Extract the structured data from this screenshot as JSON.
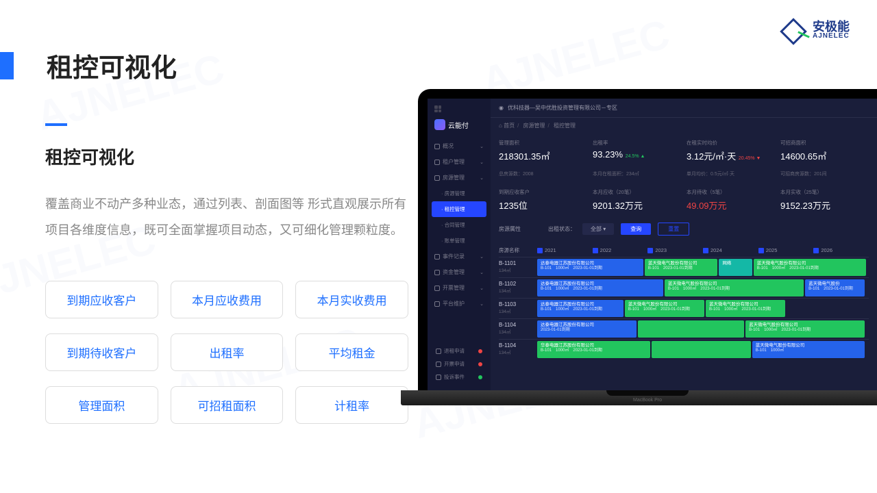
{
  "logo": {
    "cn": "安极能",
    "en": "AJNELEC"
  },
  "page": {
    "title": "租控可视化",
    "subtitle": "租控可视化",
    "desc": "覆盖商业不动产多种业态，通过列表、剖面图等 形式直观展示所有项目各维度信息，既可全面掌握项目动态，又可细化管理颗粒度。"
  },
  "tags": [
    "到期应收客户",
    "本月应收费用",
    "本月实收费用",
    "到期待收客户",
    "出租率",
    "平均租金",
    "管理面积",
    "可招租面积",
    "计租率"
  ],
  "app": {
    "brand": "云能付",
    "topbar": "优科技器—吴中优胜投资管理有限公司－专区",
    "crumb": [
      "首页",
      "房源管理",
      "租控管理"
    ],
    "nav": [
      {
        "label": "概况",
        "type": "main",
        "chev": "⌄"
      },
      {
        "label": "租户管理",
        "type": "main",
        "chev": "⌄"
      },
      {
        "label": "房源管理",
        "type": "main",
        "chev": "⌄"
      },
      {
        "label": "房源管理",
        "type": "sub"
      },
      {
        "label": "租控管理",
        "type": "sub",
        "active": true
      },
      {
        "label": "合同管理",
        "type": "sub"
      },
      {
        "label": "账单管理",
        "type": "sub"
      },
      {
        "label": "事件记录",
        "type": "main",
        "chev": "⌄"
      },
      {
        "label": "资金管理",
        "type": "main",
        "chev": "⌄"
      },
      {
        "label": "开票管理",
        "type": "main",
        "chev": "⌄"
      },
      {
        "label": "平台维护",
        "type": "main",
        "chev": "⌄"
      }
    ],
    "sidebarBottom": [
      {
        "label": "退租申请",
        "dot": "red"
      },
      {
        "label": "开票申请",
        "dot": "red"
      },
      {
        "label": "投诉事件",
        "dot": "green"
      }
    ],
    "stats": [
      {
        "label": "管理面积",
        "value": "218301.35㎡",
        "sub": "总房源数：2008"
      },
      {
        "label": "出租率",
        "value": "93.23%",
        "pct": "24.5% ▲",
        "sub": "本月在租面积：234㎡"
      },
      {
        "label": "在租实时均价",
        "value": "3.12元/㎡·天",
        "pct": "20.45% ▼",
        "pctClass": "red",
        "sub": "单月均价：0.5元/㎡·天"
      },
      {
        "label": "可招商面积",
        "value": "14600.65㎡",
        "sub": "可招商房源数：201间"
      }
    ],
    "stats2": [
      {
        "label": "到期应收客户",
        "value": "1235位"
      },
      {
        "label": "本月应收（20笔）",
        "value": "9201.32万元"
      },
      {
        "label": "本月待收（5笔）",
        "value": "49.09万元",
        "class": "red"
      },
      {
        "label": "本月实收（25笔）",
        "value": "9152.23万元"
      }
    ],
    "filter": {
      "src": "房源属性",
      "state": "出租状态：",
      "sel": "全部",
      "btn1": "查询",
      "btn2": "重置"
    },
    "ganttHead": {
      "room": "房源名称",
      "years": [
        "2021",
        "2022",
        "2023",
        "2024",
        "2025",
        "2026"
      ]
    },
    "ganttRows": [
      {
        "room": "B-1101",
        "sub": "134㎡",
        "bars": [
          {
            "w": "32%",
            "c": "blue",
            "t": "达泰电器江苏股份有限公司",
            "s": "B-101　1000㎡　2023-01-01到期"
          },
          {
            "w": "22%",
            "c": "green",
            "t": "蓝天微电气股份有限公司",
            "s": "B-101　2023-01-01到期"
          },
          {
            "w": "10%",
            "c": "teal",
            "t": "网络",
            "s": ""
          },
          {
            "w": "34%",
            "c": "green",
            "t": "蓝天微电气股份有限公司",
            "s": "B-101　1000㎡　2023-01-01到期"
          }
        ]
      },
      {
        "room": "B-1102",
        "sub": "134㎡",
        "bars": [
          {
            "w": "38%",
            "c": "blue",
            "t": "达泰电器江苏股份有限公司",
            "s": "B-101　1000㎡　2023-01-01到期"
          },
          {
            "w": "42%",
            "c": "green",
            "t": "蓝天微电气股份有限公司",
            "s": "B-101　1000㎡　2023-01-01到期"
          },
          {
            "w": "18%",
            "c": "blue",
            "t": "蓝天微电气股份",
            "s": "B-101　2023-01-01到期"
          }
        ]
      },
      {
        "room": "B-1103",
        "sub": "134㎡",
        "bars": [
          {
            "w": "26%",
            "c": "blue",
            "t": "达泰电器江苏股份有限公司",
            "s": "B-101　1000㎡　2023-01-01到期"
          },
          {
            "w": "24%",
            "c": "green",
            "t": "蓝天微电气股份有限公司",
            "s": "B-101　1000㎡　2023-01-01到期"
          },
          {
            "w": "24%",
            "c": "green",
            "t": "蓝天微电气股份有限公司",
            "s": "B-101　1000㎡　2023-01-01到期"
          }
        ]
      },
      {
        "room": "B-1104",
        "sub": "134㎡",
        "bars": [
          {
            "w": "30%",
            "c": "blue",
            "t": "达泰电器江苏股份有限公司",
            "s": "2023-01-01到期"
          },
          {
            "w": "32%",
            "c": "green",
            "t": "",
            "s": ""
          },
          {
            "w": "36%",
            "c": "green",
            "t": "蓝天微电气股份有限公司",
            "s": "B-101　1000㎡　2023-01-01到期"
          }
        ]
      },
      {
        "room": "B-1104",
        "sub": "134㎡",
        "bars": [
          {
            "w": "34%",
            "c": "green",
            "t": "华泰电器江苏股份有限公司",
            "s": "B-101　1000㎡　2023-01-01到期"
          },
          {
            "w": "30%",
            "c": "green",
            "t": "",
            "s": ""
          },
          {
            "w": "34%",
            "c": "blue",
            "t": "蓝天微电气股份有限公司",
            "s": "B-101　1000㎡"
          }
        ]
      }
    ]
  },
  "laptop": {
    "model": "MacBook Pro"
  }
}
